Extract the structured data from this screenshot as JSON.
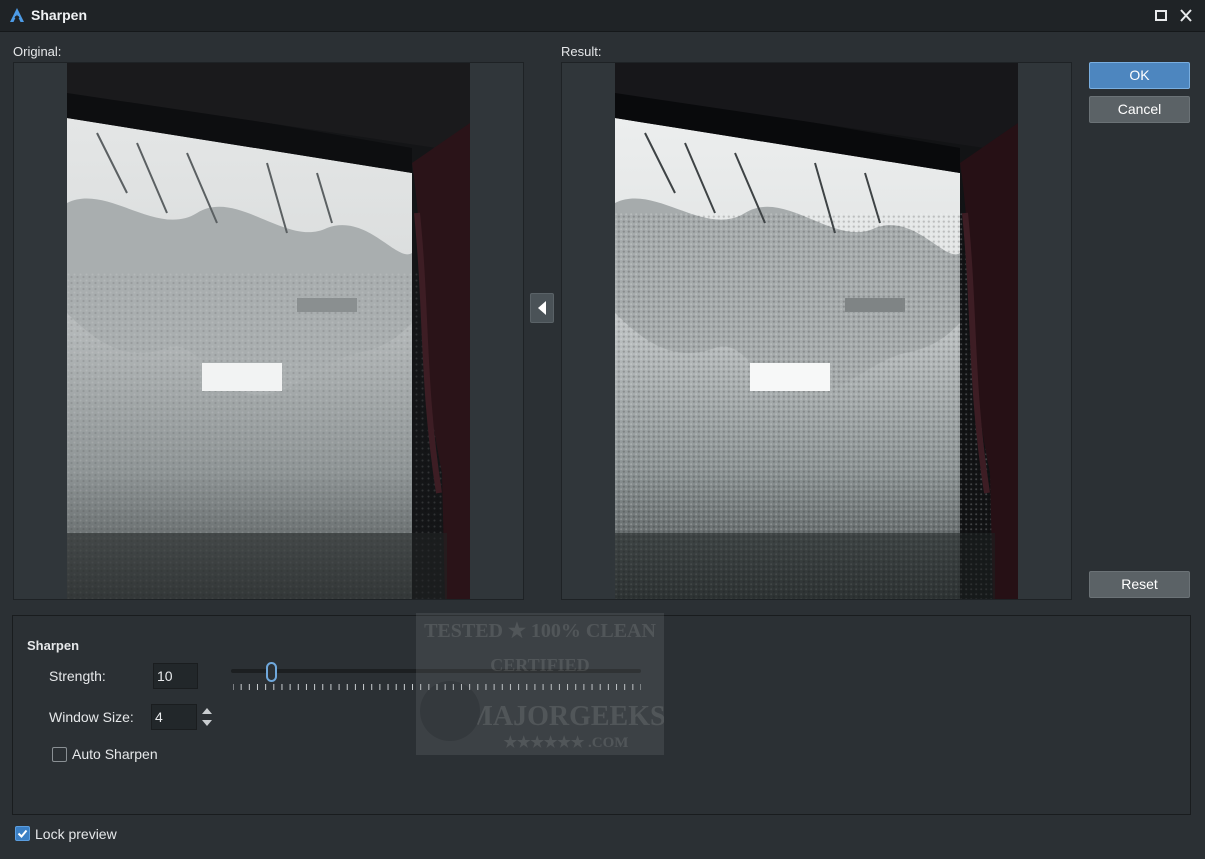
{
  "window": {
    "title": "Sharpen",
    "icons": {
      "app": "app-logo-icon",
      "maximize": "maximize-icon",
      "close": "close-icon"
    }
  },
  "preview": {
    "original_label": "Original:",
    "result_label": "Result:",
    "swap_icon": "arrow-left-icon"
  },
  "buttons": {
    "ok": "OK",
    "cancel": "Cancel",
    "reset": "Reset"
  },
  "sharpen_group": {
    "title": "Sharpen",
    "strength_label": "Strength:",
    "strength_value": "10",
    "strength_slider_fraction": 0.1,
    "window_size_label": "Window Size:",
    "window_size_value": "4",
    "auto_sharpen_label": "Auto Sharpen",
    "auto_sharpen_checked": false
  },
  "footer": {
    "lock_preview_label": "Lock preview",
    "lock_preview_checked": true
  },
  "watermark": {
    "line1": "TESTED ★ 100% CLEAN",
    "line2": "CERTIFIED",
    "line3": "MAJORGEEKS",
    "line4": "★★★★★★ .COM"
  },
  "colors": {
    "accent": "#4d86bf",
    "background": "#2b3034",
    "titlebar": "#1f2326"
  }
}
